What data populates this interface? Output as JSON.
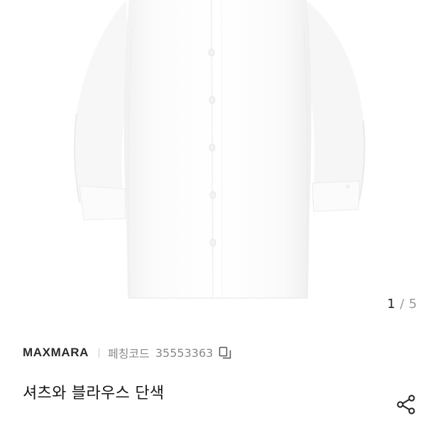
{
  "gallery": {
    "current_page": "1",
    "separator": "/",
    "total_pages": "5"
  },
  "product": {
    "brand": "MAXMARA",
    "code_label": "페칭코드",
    "code_value": "35553363",
    "title": "셔츠와 블라우스 단색"
  },
  "icons": {
    "copy": "copy-icon",
    "share": "share-icon"
  }
}
